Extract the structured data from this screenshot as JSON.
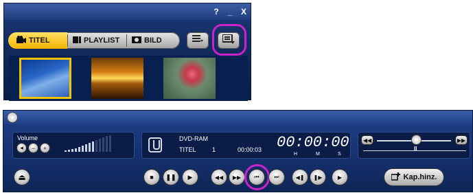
{
  "navigator": {
    "help_label": "?",
    "minimize_label": "_",
    "close_label": "X",
    "tabs": [
      {
        "label": "TITEL",
        "icon": "camera-icon",
        "active": true
      },
      {
        "label": "PLAYLIST",
        "icon": "playlist-icon",
        "active": false
      },
      {
        "label": "BILD",
        "icon": "picture-icon",
        "active": false
      }
    ],
    "thumbnails": [
      {
        "scene": "blue sky",
        "selected": true
      },
      {
        "scene": "sunset over water",
        "selected": false
      },
      {
        "scene": "flamingo",
        "selected": false
      }
    ]
  },
  "controller": {
    "volume": {
      "label": "Volume"
    },
    "display": {
      "media": "DVD-RAM",
      "title_label": "TITEL",
      "title_number": "1",
      "elapsed": "00:00:03",
      "big_time": "00:00:00",
      "h": "H",
      "m": "M",
      "s": "S"
    },
    "speed": {
      "pause_mark": "II"
    },
    "add_chapter_label": "Kap.hinz."
  },
  "colors": {
    "accent": "#f3b400",
    "highlight": "#cc22cc",
    "panel": "#163170"
  }
}
